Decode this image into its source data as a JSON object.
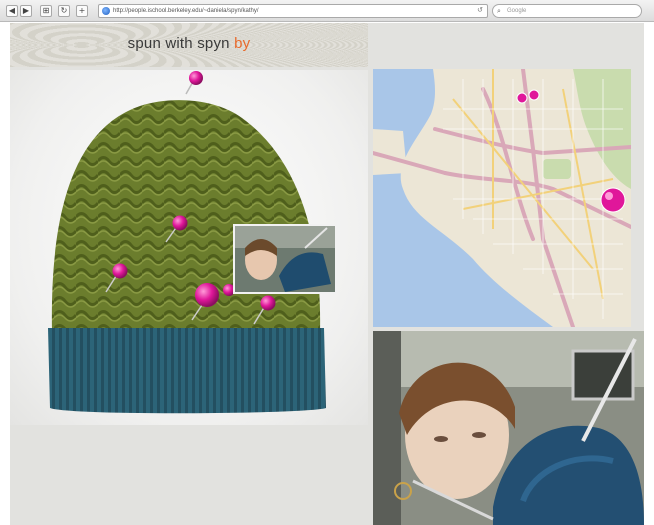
{
  "browser": {
    "back_glyph": "◀",
    "forward_glyph": "▶",
    "view_glyph": "⊞",
    "reload_glyph": "↻",
    "add_glyph": "+",
    "url": "http://people.ischool.berkeley.edu/~daniela/spyn/kathy/",
    "url_reload_glyph": "↺",
    "search_placeholder": "Google",
    "search_icon": "search-icon"
  },
  "banner": {
    "title": "spun with spyn",
    "by": "by"
  },
  "colors": {
    "pin": "#e0179a",
    "hat_green": "#6b7d2d",
    "hat_teal": "#2c6478",
    "brand_accent": "#e86a2c"
  },
  "panels": {
    "knitted_item": "knit-hat-with-pins",
    "map": "bay-area-map-with-pins",
    "video": "knitter-video-frame"
  }
}
